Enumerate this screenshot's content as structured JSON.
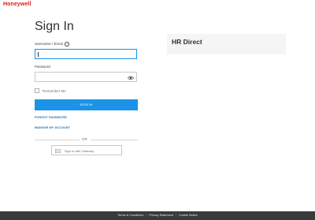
{
  "brand": {
    "logo_text": "Honeywell",
    "accent_color": "#e0181c",
    "link_color": "#1b6fb3",
    "button_color": "#1c93e6"
  },
  "page": {
    "title": "Sign In"
  },
  "form": {
    "username_label": "Username / Email",
    "username_value": "",
    "password_label": "Password",
    "password_value": "",
    "remember_label": "Remember Me",
    "remember_checked": false,
    "signin_label": "SIGN IN",
    "forgot_password": "FORGOT PASSWORD",
    "manage_account": "MANAGE MY ACCOUNT",
    "or_label": "OR",
    "sso_label": "Sign in with Gateway",
    "icons": [
      "info-icon",
      "eye-icon",
      "sso-icon"
    ]
  },
  "side": {
    "title": "HR Direct"
  },
  "footer": {
    "links": [
      "Terms & Conditions",
      "Privacy Statement",
      "Cookie Notice"
    ]
  }
}
